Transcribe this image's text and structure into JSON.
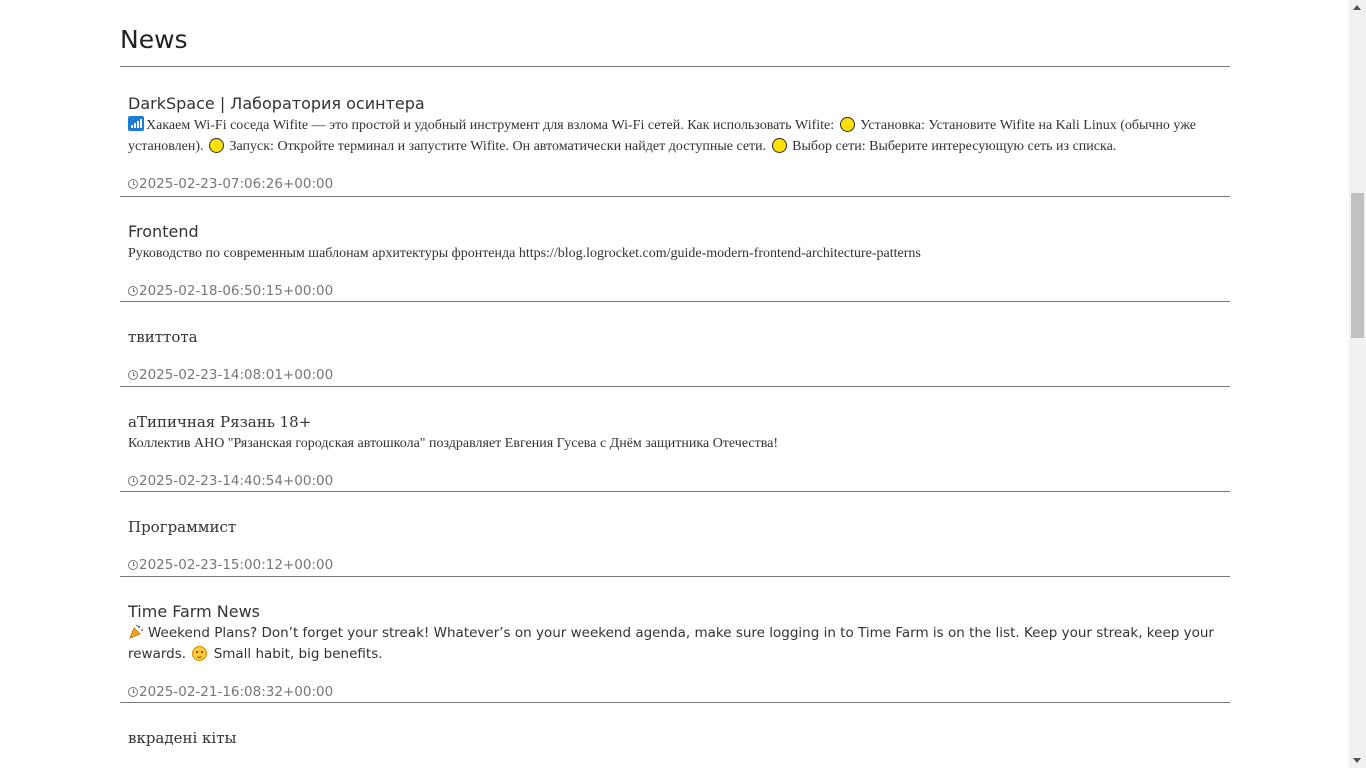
{
  "page": {
    "title": "News"
  },
  "news": [
    {
      "channel": "DarkSpace | Лаборатория осинтера",
      "text_parts": {
        "p1": "Хакаем Wi-Fi соседа Wifite — это простой и удобный инструмент для взлома Wi-Fi сетей. Как использовать Wifite:",
        "p2": "Установка: Установите Wifite на Kali Linux (обычно уже установлен).",
        "p3": "Запуск: Откройте терминал и запустите Wifite. Он автоматически найдет доступные сети.",
        "p4": "Выбор сети: Выберите интересующую сеть из списка."
      },
      "date": "2025-02-23-07:06:26+00:00",
      "icons": [
        "signal-bars-icon",
        "yellow-circle-icon"
      ]
    },
    {
      "channel": "Frontend",
      "text": "Руководство по современным шаблонам архитектуры фронтенда https://blog.logrocket.com/guide-modern-frontend-architecture-patterns",
      "date": "2025-02-18-06:50:15+00:00"
    },
    {
      "channel": "твиттота",
      "text": "",
      "date": "2025-02-23-14:08:01+00:00"
    },
    {
      "channel": "аТипичная Рязань 18+",
      "text": "Коллектив АНО \"Рязанская городская автошкола\" поздравляет Евгения Гусева с Днём защитника Отечества!",
      "date": "2025-02-23-14:40:54+00:00"
    },
    {
      "channel": "Программист",
      "text": "",
      "date": "2025-02-23-15:00:12+00:00"
    },
    {
      "channel": "Time Farm News",
      "text_parts": {
        "p1": "Weekend Plans? Don’t forget your streak! Whatever’s on your weekend agenda, make sure logging in to Time Farm is on the list. Keep your streak, keep your rewards.",
        "p2": "Small habit, big benefits."
      },
      "date": "2025-02-21-16:08:32+00:00",
      "icons": [
        "party-emoji-icon",
        "smiling-face-icon"
      ]
    },
    {
      "channel": "вкрадені кіты",
      "text": "",
      "date": ""
    }
  ],
  "colors": {
    "divider": "#777777",
    "date_text": "#777777",
    "text": "#333333",
    "scrollbar_track": "#f1f1f1",
    "scrollbar_thumb": "#c1c1c1"
  }
}
